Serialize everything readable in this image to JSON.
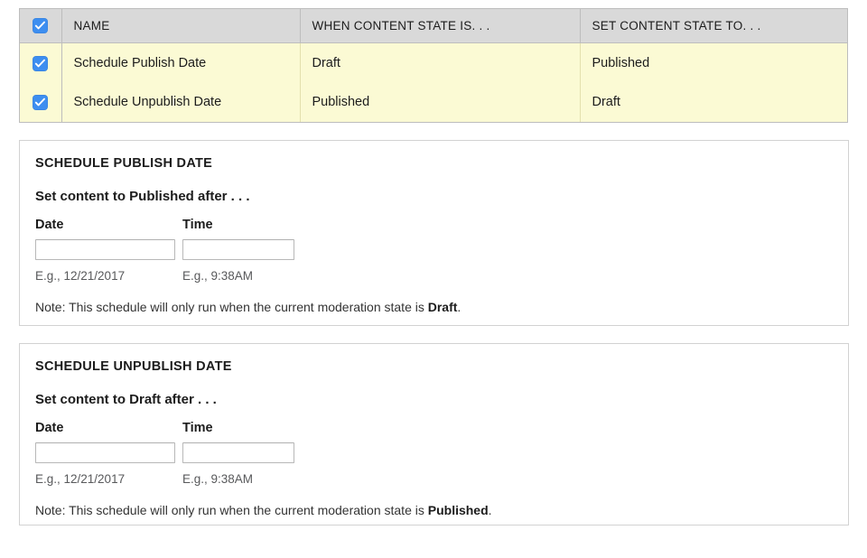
{
  "table": {
    "select_all_checkbox": "checked",
    "columns": [
      {
        "key": "check",
        "label": ""
      },
      {
        "key": "name",
        "label": "NAME"
      },
      {
        "key": "when",
        "label": "WHEN CONTENT STATE IS. . ."
      },
      {
        "key": "set",
        "label": "SET CONTENT STATE TO. . ."
      }
    ],
    "rows": [
      {
        "checked": true,
        "name": "Schedule Publish Date",
        "when": "Draft",
        "set": "Published"
      },
      {
        "checked": true,
        "name": "Schedule Unpublish Date",
        "when": "Published",
        "set": "Draft"
      }
    ]
  },
  "panels": [
    {
      "title": "SCHEDULE PUBLISH DATE",
      "subtitle": "Set content to Published after . . .",
      "date": {
        "label": "Date",
        "value": "",
        "placeholder": "",
        "description": "E.g., 12/21/2017"
      },
      "time": {
        "label": "Time",
        "value": "",
        "placeholder": "",
        "description": "E.g., 9:38AM"
      },
      "note_prefix": "Note: This schedule will only run when the current moderation state is ",
      "note_state": "Draft",
      "note_suffix": "."
    },
    {
      "title": "SCHEDULE UNPUBLISH DATE",
      "subtitle": "Set content to Draft after . . .",
      "date": {
        "label": "Date",
        "value": "",
        "placeholder": "",
        "description": "E.g., 12/21/2017"
      },
      "time": {
        "label": "Time",
        "value": "",
        "placeholder": "",
        "description": "E.g., 9:38AM"
      },
      "note_prefix": "Note: This schedule will only run when the current moderation state is ",
      "note_state": "Published",
      "note_suffix": "."
    }
  ],
  "colors": {
    "row_highlight": "#fbfad4",
    "header_gray": "#d9d9d9",
    "checkbox_blue": "#3d8ef0",
    "border_gray": "#bdbdbd"
  }
}
